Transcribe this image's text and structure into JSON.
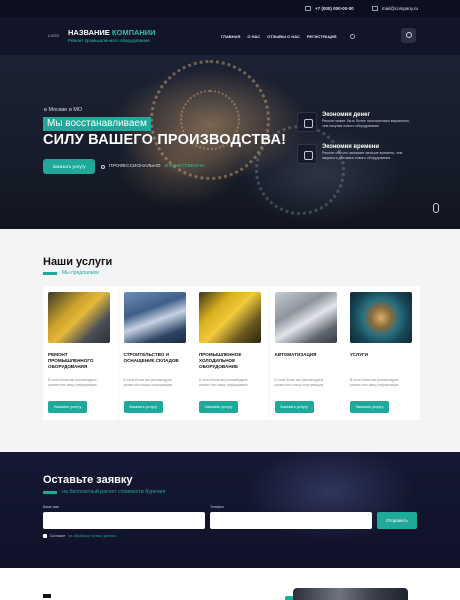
{
  "topbar": {
    "phone": "+7 (000) 000-00-00",
    "email": "mail@company.ru"
  },
  "header": {
    "logo": "LOGO",
    "brand_name_part1": "НАЗВАНИЕ",
    "brand_name_part2": "КОМПАНИИ",
    "brand_sub": "Ремонт промышленного оборудования",
    "nav": [
      "ГЛАВНАЯ",
      "О НАС",
      "ОТЗЫВЫ О НАС",
      "РЕГИСТРАЦИЯ"
    ]
  },
  "hero": {
    "sub": "в Москве и МО",
    "title1": "Мы восстанавливаем",
    "title2": "СИЛУ ВАШЕГО ПРОИЗВОДСТВА!",
    "button": "Заказать услугу",
    "note_prefix": "ПРОФЕССИОНАЛЬНО",
    "note_highlight": "И КАЧЕСТВЕННО",
    "advantages": [
      {
        "title": "Экономия денег",
        "text": "Ремонт может быть более экономичным вариантом, чем покупка нового оборудования"
      },
      {
        "title": "Экономия времени",
        "text": "Ремонт обычно занимает меньше времени, чем закупка и доставка нового оборудования"
      }
    ]
  },
  "services": {
    "title": "Наши услуги",
    "subtitle": "Мы предлагаем",
    "card_text": "В этом блоке мы рекомендуем разместить вашу информацию",
    "card_button": "Заказать услугу",
    "cards": [
      {
        "title": "Ремонт промышленного оборудования"
      },
      {
        "title": "Строительство и оснащение складов"
      },
      {
        "title": "Промышленное холодильное оборудование"
      },
      {
        "title": "Автоматизация"
      },
      {
        "title": "Услуги"
      }
    ]
  },
  "request": {
    "title": "Оставьте заявку",
    "subtitle": "на бесплатный расчет стоимости бурения",
    "name_label": "Ваше имя",
    "phone_label": "Телефон",
    "name_value": "",
    "phone_value": "",
    "button": "Отправить",
    "agree_prefix": "Согласие",
    "agree_link": "на обработку личных данных"
  },
  "colors": {
    "accent": "#1ea99a",
    "dark": "#12152a"
  }
}
